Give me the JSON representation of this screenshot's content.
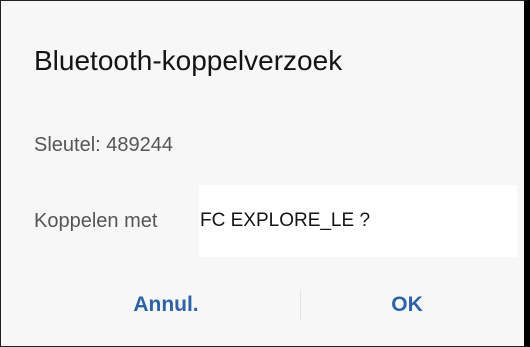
{
  "dialog": {
    "title": "Bluetooth-koppelverzoek",
    "key_line": "Sleutel: 489244",
    "pair_prefix": "Koppelen met",
    "device_name": "FC EXPLORE_LE ?",
    "cancel_label": "Annul.",
    "ok_label": "OK"
  },
  "colors": {
    "background": "#f7f7f7",
    "title_text": "#141414",
    "body_text": "#555555",
    "button_text": "#2e62a6"
  }
}
